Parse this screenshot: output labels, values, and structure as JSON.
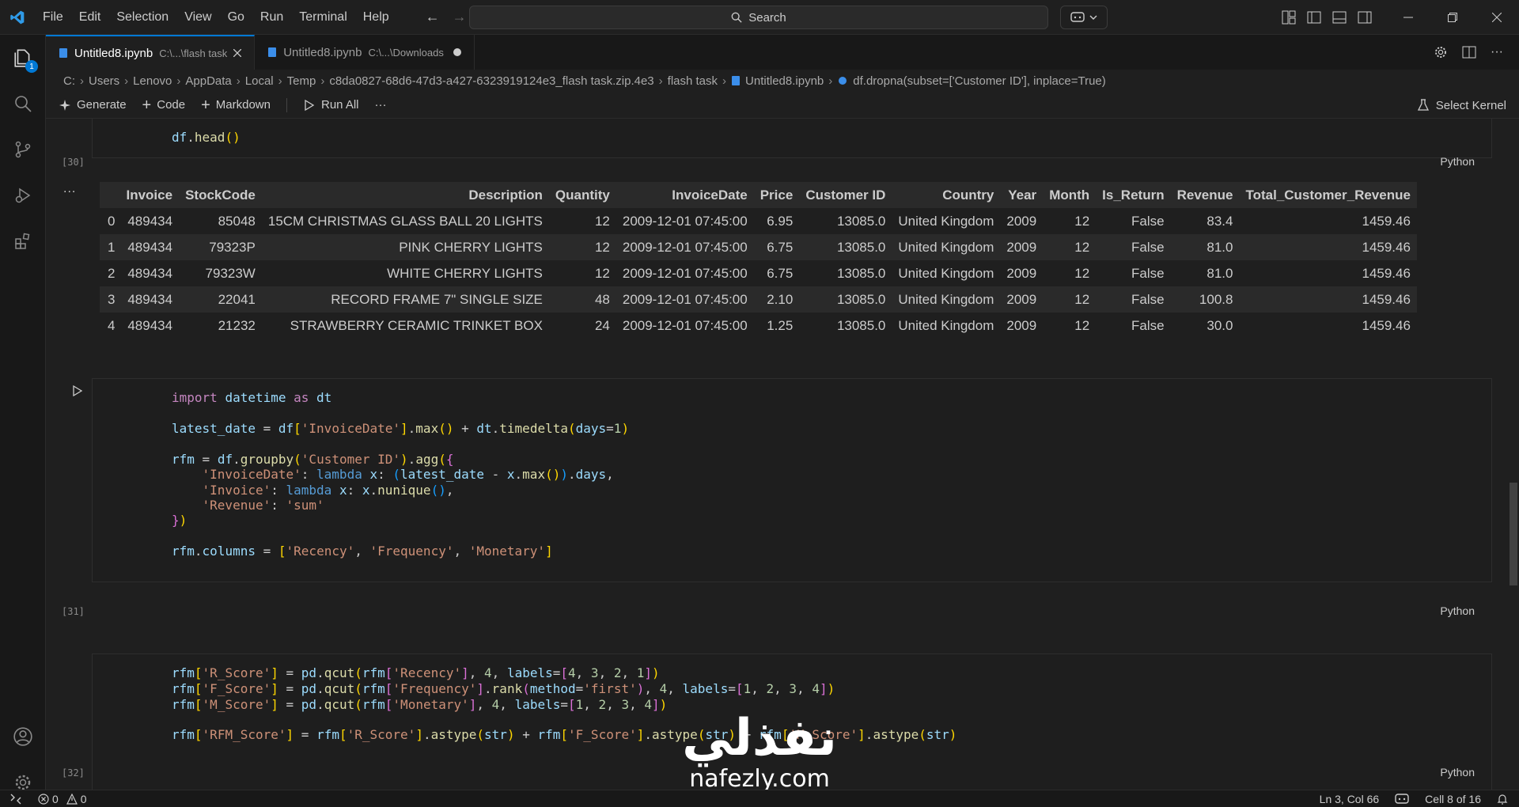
{
  "menu": {
    "items": [
      "File",
      "Edit",
      "Selection",
      "View",
      "Go",
      "Run",
      "Terminal",
      "Help"
    ],
    "search_label": "Search"
  },
  "activity_bar": {
    "explorer_badge": "1"
  },
  "tabs": [
    {
      "name": "Untitled8.ipynb",
      "path": "C:\\...\\flash task"
    },
    {
      "name": "Untitled8.ipynb",
      "path": "C:\\...\\Downloads"
    }
  ],
  "breadcrumb": [
    "C:",
    "Users",
    "Lenovo",
    "AppData",
    "Local",
    "Temp",
    "c8da0827-68d6-47d3-a427-6323919124e3_flash task.zip.4e3",
    "flash task",
    "Untitled8.ipynb",
    "df.dropna(subset=['Customer ID'], inplace=True)"
  ],
  "toolbar": {
    "generate": "Generate",
    "code": "Code",
    "markdown": "Markdown",
    "run_all": "Run All",
    "more": "···",
    "select_kernel": "Select Kernel"
  },
  "cells": {
    "c30": {
      "exec": "[30]",
      "lang": "Python",
      "output_dots": "...",
      "columns": [
        "",
        "Invoice",
        "StockCode",
        "Description",
        "Quantity",
        "InvoiceDate",
        "Price",
        "Customer ID",
        "Country",
        "Year",
        "Month",
        "Is_Return",
        "Revenue",
        "Total_Customer_Revenue"
      ],
      "rows": [
        [
          "0",
          "489434",
          "85048",
          "15CM CHRISTMAS GLASS BALL 20 LIGHTS",
          "12",
          "2009-12-01 07:45:00",
          "6.95",
          "13085.0",
          "United Kingdom",
          "2009",
          "12",
          "False",
          "83.4",
          "1459.46"
        ],
        [
          "1",
          "489434",
          "79323P",
          "PINK CHERRY LIGHTS",
          "12",
          "2009-12-01 07:45:00",
          "6.75",
          "13085.0",
          "United Kingdom",
          "2009",
          "12",
          "False",
          "81.0",
          "1459.46"
        ],
        [
          "2",
          "489434",
          "79323W",
          "WHITE CHERRY LIGHTS",
          "12",
          "2009-12-01 07:45:00",
          "6.75",
          "13085.0",
          "United Kingdom",
          "2009",
          "12",
          "False",
          "81.0",
          "1459.46"
        ],
        [
          "3",
          "489434",
          "22041",
          "RECORD FRAME 7\" SINGLE SIZE",
          "48",
          "2009-12-01 07:45:00",
          "2.10",
          "13085.0",
          "United Kingdom",
          "2009",
          "12",
          "False",
          "100.8",
          "1459.46"
        ],
        [
          "4",
          "489434",
          "21232",
          "STRAWBERRY CERAMIC TRINKET BOX",
          "24",
          "2009-12-01 07:45:00",
          "1.25",
          "13085.0",
          "United Kingdom",
          "2009",
          "12",
          "False",
          "30.0",
          "1459.46"
        ]
      ]
    },
    "c31": {
      "exec": "[31]",
      "lang": "Python"
    },
    "c32": {
      "exec": "[32]",
      "lang": "Python"
    }
  },
  "status": {
    "errors": "0",
    "warnings": "0",
    "position": "Ln 3, Col 66",
    "cell": "Cell 8 of 16"
  },
  "watermark": {
    "arabic": "نفذلي",
    "latin": "nafezly.com"
  }
}
